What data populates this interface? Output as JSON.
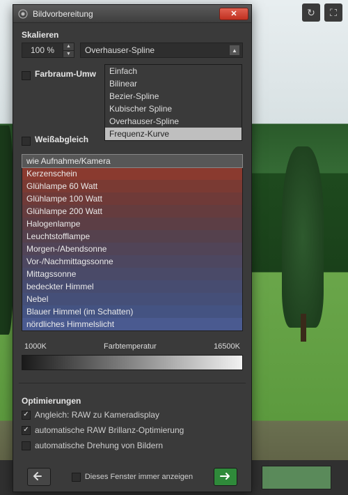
{
  "window": {
    "title": "Bildvorbereitung"
  },
  "skalieren": {
    "heading": "Skalieren",
    "value": "100 %",
    "combo_value": "Overhauser-Spline",
    "options": [
      "Einfach",
      "Bilinear",
      "Bezier-Spline",
      "Kubischer Spline",
      "Overhauser-Spline",
      "Frequenz-Kurve"
    ],
    "highlight_index": 5
  },
  "farbraum": {
    "label": "Farbraum-Umw"
  },
  "weissabgleich": {
    "heading": "Weißabgleich",
    "items": [
      {
        "label": "wie Aufnahme/Kamera",
        "bg": "#575757"
      },
      {
        "label": "Kerzenschein",
        "bg": "#8a3a2f"
      },
      {
        "label": "Glühlampe 60 Watt",
        "bg": "#7a3a33"
      },
      {
        "label": "Glühlampe 100 Watt",
        "bg": "#6f3a38"
      },
      {
        "label": "Glühlampe 200 Watt",
        "bg": "#653c3e"
      },
      {
        "label": "Halogenlampe",
        "bg": "#5c3e45"
      },
      {
        "label": "Leuchtstofflampe",
        "bg": "#55414d"
      },
      {
        "label": "Morgen-/Abendsonne",
        "bg": "#514457"
      },
      {
        "label": "Vor-/Nachmittagssonne",
        "bg": "#4d4760"
      },
      {
        "label": "Mittagssonne",
        "bg": "#4a4a68"
      },
      {
        "label": "bedeckter Himmel",
        "bg": "#474c70"
      },
      {
        "label": "Nebel",
        "bg": "#454f78"
      },
      {
        "label": "Blauer Himmel (im Schatten)",
        "bg": "#445382"
      },
      {
        "label": "nördliches Himmelslicht",
        "bg": "#4a5a90"
      }
    ],
    "selected_index": 0,
    "temp_min": "1000K",
    "temp_label": "Farbtemperatur",
    "temp_max": "16500K"
  },
  "optimierungen": {
    "heading": "Optimierungen",
    "items": [
      {
        "label": "Angleich: RAW zu Kameradisplay",
        "checked": true
      },
      {
        "label": "automatische RAW Brillanz-Optimierung",
        "checked": true
      },
      {
        "label": "automatische Drehung von Bildern",
        "checked": false
      }
    ]
  },
  "footer": {
    "always_show": "Dieses Fenster immer anzeigen"
  }
}
